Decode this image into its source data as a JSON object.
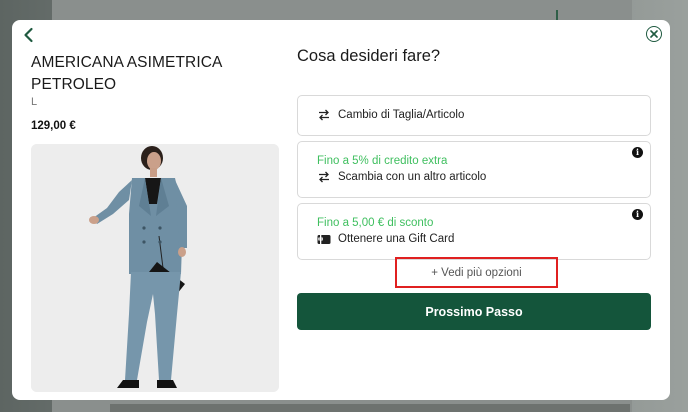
{
  "product": {
    "title": "AMERICANA ASIMETRICA PETROLEO",
    "size": "L",
    "price": "129,00 €"
  },
  "panel": {
    "question": "Cosa desideri fare?",
    "options": [
      {
        "label": "Cambio di Taglia/Articolo",
        "icon": "swap-arrows-icon"
      },
      {
        "promo": "Fino a 5% di credito extra",
        "label": "Scambia con un altro articolo",
        "icon": "swap-arrows-icon",
        "info": "i"
      },
      {
        "promo": "Fino a 5,00 € di sconto",
        "label": "Ottenere una Gift Card",
        "icon": "gift-card-icon",
        "info": "i"
      }
    ],
    "more_options": "+ Vedi più opzioni",
    "next_button": "Prossimo Passo"
  },
  "colors": {
    "accent": "#14553b",
    "promo": "#3fbf5f",
    "highlight": "#e02020"
  }
}
